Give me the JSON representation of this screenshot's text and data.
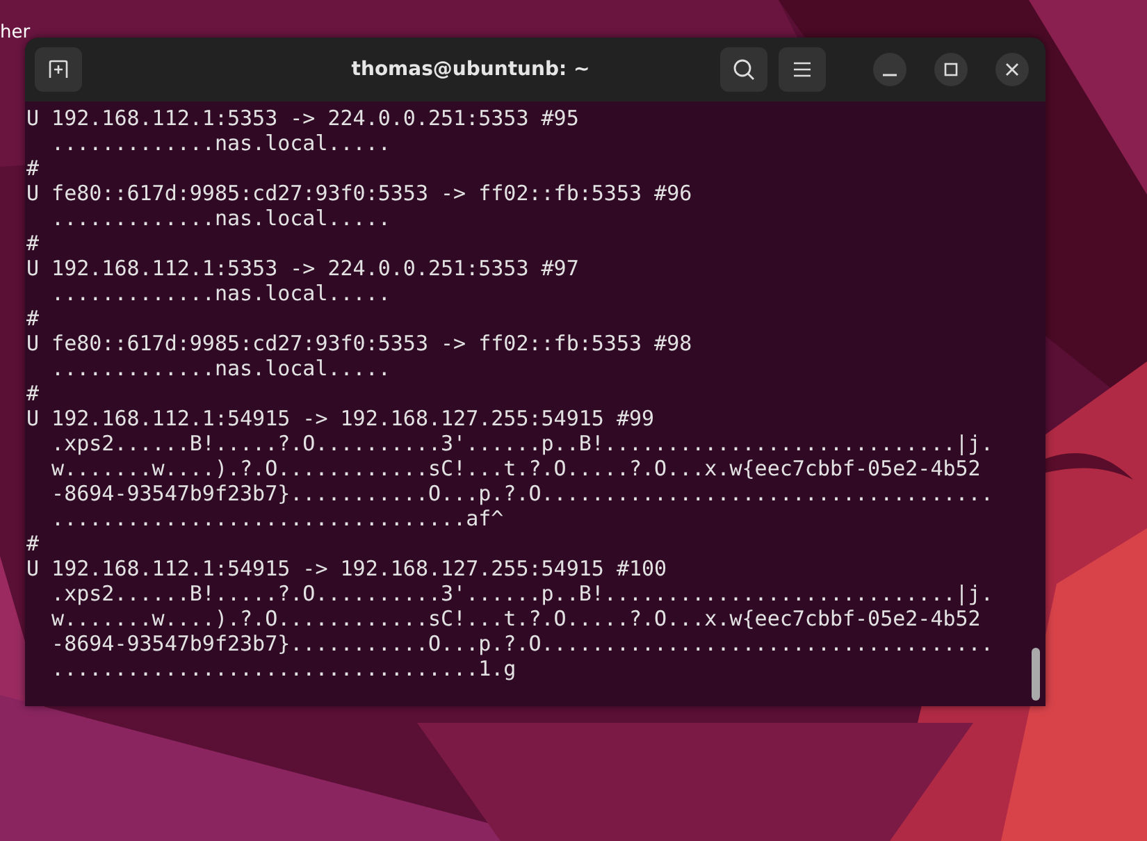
{
  "desktop": {
    "icon_label": "her"
  },
  "window": {
    "title": "thomas@ubuntunb: ~"
  },
  "terminal": {
    "lines": [
      "U 192.168.112.1:5353 -> 224.0.0.251:5353 #95",
      "  .............nas.local.....",
      "#",
      "U fe80::617d:9985:cd27:93f0:5353 -> ff02::fb:5353 #96",
      "  .............nas.local.....",
      "#",
      "U 192.168.112.1:5353 -> 224.0.0.251:5353 #97",
      "  .............nas.local.....",
      "#",
      "U fe80::617d:9985:cd27:93f0:5353 -> ff02::fb:5353 #98",
      "  .............nas.local.....",
      "#",
      "U 192.168.112.1:54915 -> 192.168.127.255:54915 #99",
      "  .xps2......B!.....?.O..........3'......p..B!............................|j.",
      "  w.......w....).?.O............sC!...t.?.O.....?.O...x.w{eec7cbbf-05e2-4b52",
      "  -8694-93547b9f23b7}...........O...p.?.O....................................",
      "  .................................af^",
      "#",
      "U 192.168.112.1:54915 -> 192.168.127.255:54915 #100",
      "  .xps2......B!.....?.O..........3'......p..B!............................|j.",
      "  w.......w....).?.O............sC!...t.?.O.....?.O...x.w{eec7cbbf-05e2-4b52",
      "  -8694-93547b9f23b7}...........O...p.?.O....................................",
      "  ..................................1.g"
    ]
  }
}
